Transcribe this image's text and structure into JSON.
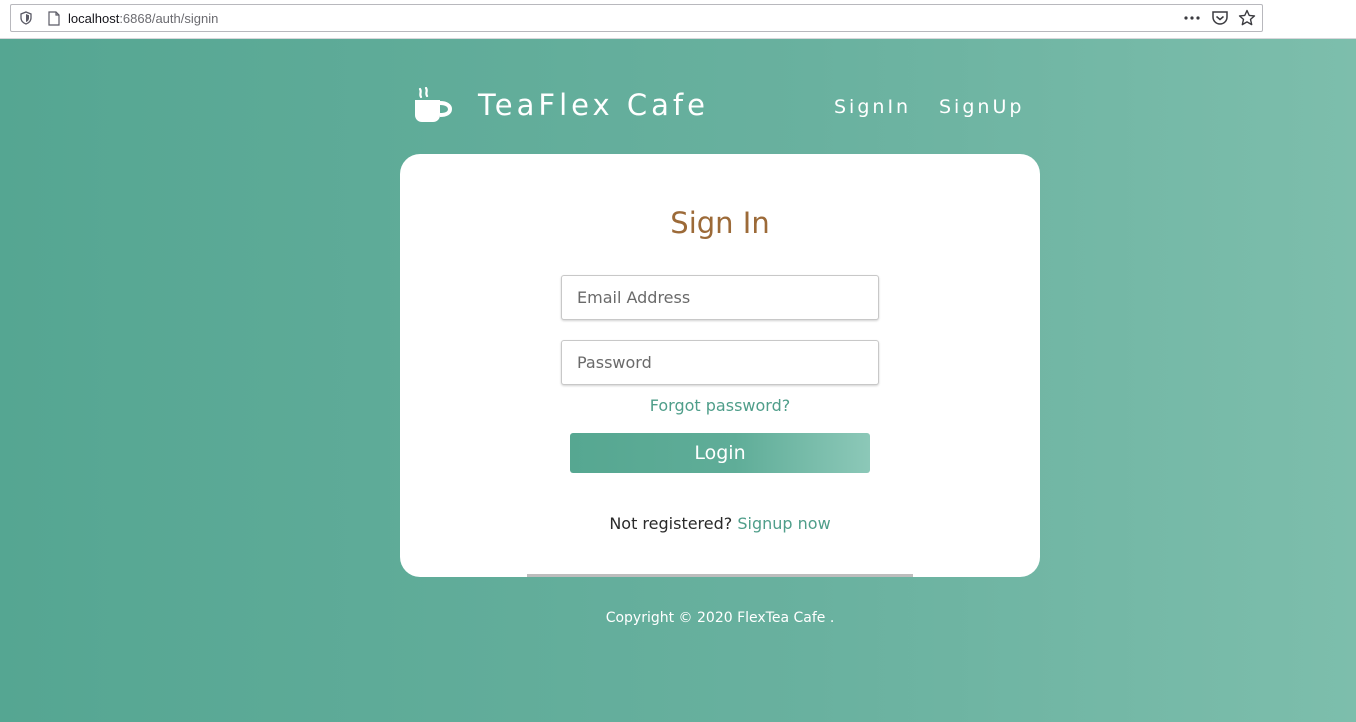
{
  "browser": {
    "url_host": "localhost",
    "url_path": ":6868/auth/signin",
    "icons": [
      "shield-icon",
      "page-icon",
      "more-icon",
      "pocket-icon",
      "star-icon"
    ]
  },
  "header": {
    "brand": "TeaFlex Cafe",
    "logo_icon": "coffee-cup-icon",
    "nav": {
      "signin": "SignIn",
      "signup": "SignUp"
    }
  },
  "form": {
    "title": "Sign In",
    "email_placeholder": "Email Address",
    "email_value": "",
    "password_placeholder": "Password",
    "password_value": "",
    "forgot_label": "Forgot password?",
    "login_label": "Login",
    "register_prompt": "Not registered?",
    "signup_label": "Signup now"
  },
  "footer": {
    "copyright": "Copyright © 2020 FlexTea Cafe ."
  },
  "colors": {
    "background_start": "#55a692",
    "background_end": "#7dbeac",
    "title_brown": "#9c6a38",
    "link_teal": "#4f9e8a",
    "card": "#ffffff"
  }
}
